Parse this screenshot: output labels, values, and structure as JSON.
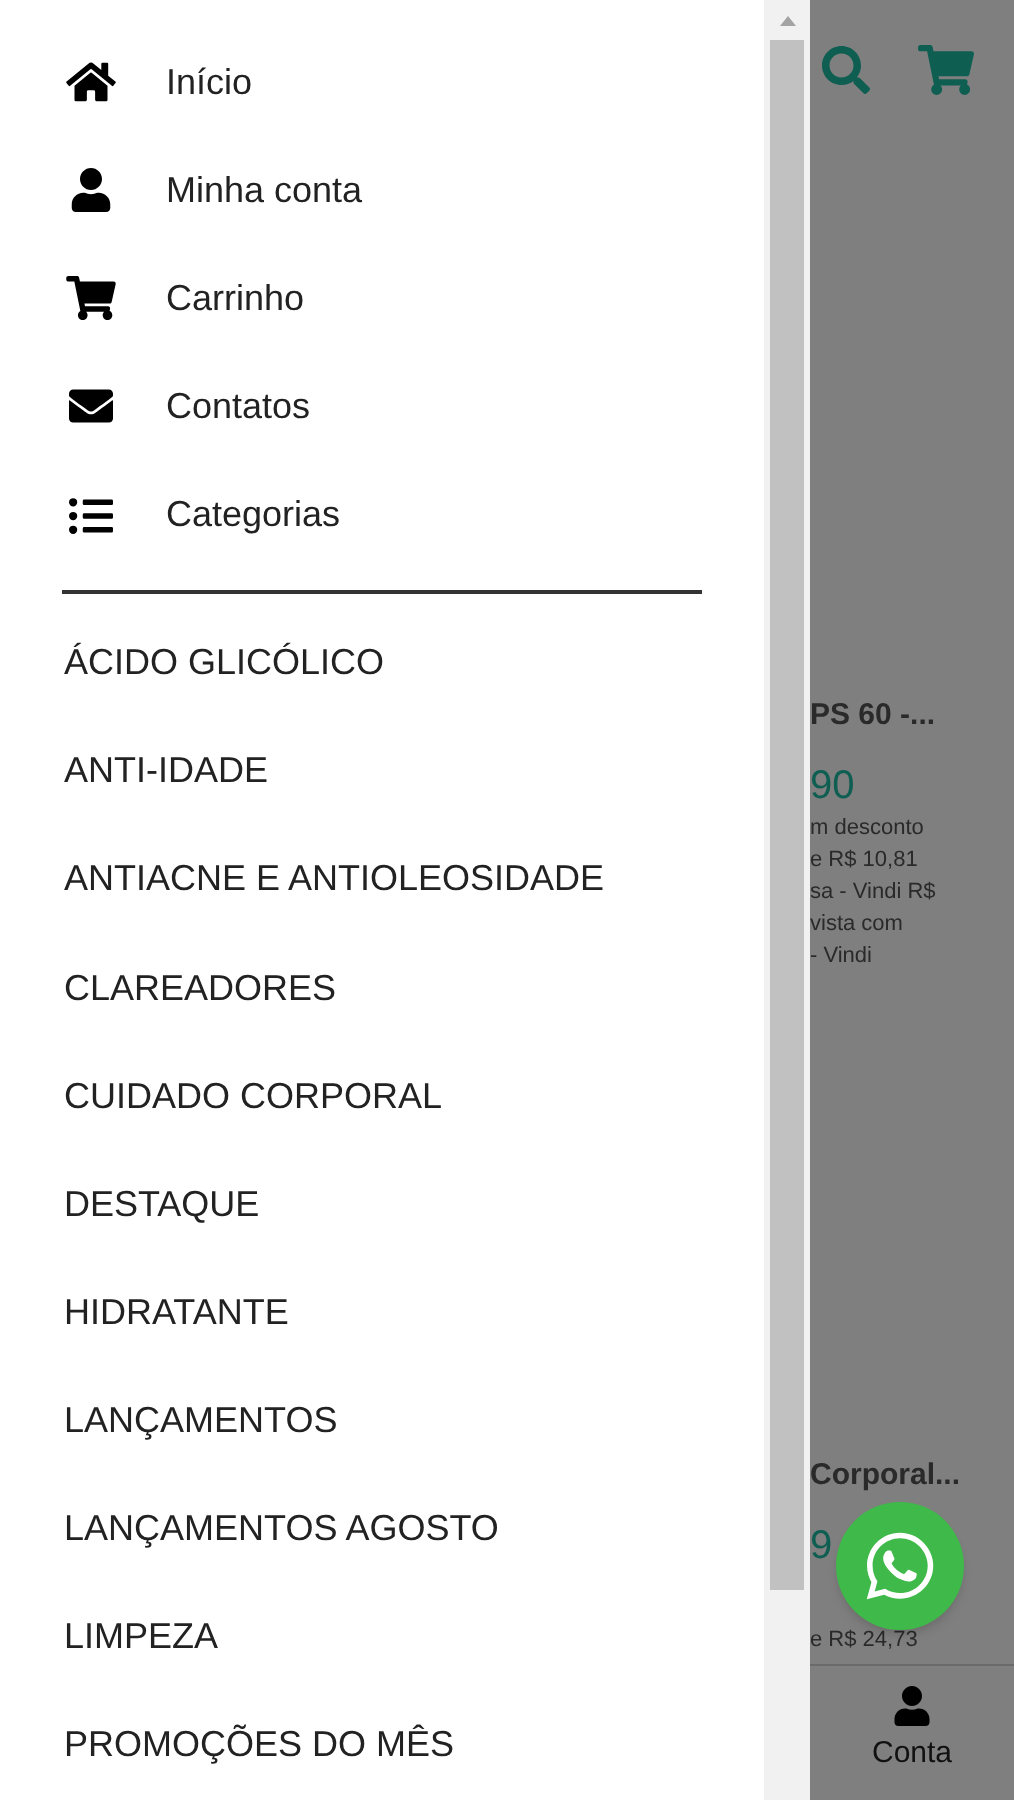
{
  "menu": [
    {
      "label": "Início",
      "kind": "home"
    },
    {
      "label": "Minha conta",
      "kind": "account"
    },
    {
      "label": "Carrinho",
      "kind": "cart"
    },
    {
      "label": "Contatos",
      "kind": "contact"
    },
    {
      "label": "Categorias",
      "kind": "categories"
    }
  ],
  "categories": [
    "ÁCIDO GLICÓLICO",
    "ANTI-IDADE",
    "ANTIACNE E ANTIOLEOSIDADE",
    "CLAREADORES",
    "CUIDADO CORPORAL",
    "DESTAQUE",
    "HIDRATANTE",
    "LANÇAMENTOS",
    "LANÇAMENTOS AGOSTO",
    "LIMPEZA",
    "PROMOÇÕES DO MÊS"
  ],
  "background_page": {
    "product_1": {
      "title": "PS 60 -...",
      "price": "90",
      "lines": [
        "m desconto",
        "e R$ 10,81",
        "sa - Vindi R$",
        "vista com",
        "- Vindi"
      ]
    },
    "product_2": {
      "title": "Corporal...",
      "price": "9",
      "lines": [
        "e R$ 24,73"
      ]
    },
    "bottom_nav": {
      "label": "Conta"
    }
  }
}
